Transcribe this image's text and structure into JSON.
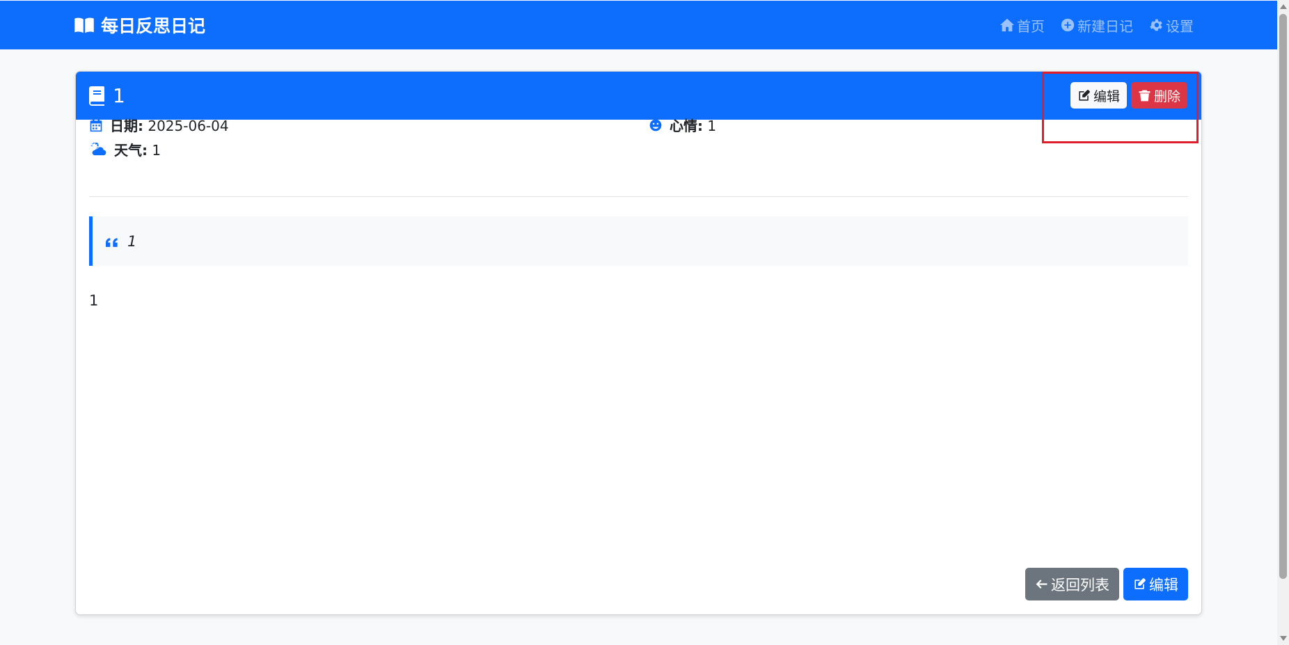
{
  "navbar": {
    "brand": "每日反思日记",
    "links": [
      {
        "label": "首页",
        "icon": "home-icon"
      },
      {
        "label": "新建日记",
        "icon": "plus-circle-icon"
      },
      {
        "label": "设置",
        "icon": "gear-icon"
      }
    ]
  },
  "entry": {
    "title": "1",
    "actions": {
      "edit": "编辑",
      "delete": "删除"
    },
    "date_label": "日期:",
    "date_value": "2025-06-04",
    "mood_label": "心情:",
    "mood_value": "1",
    "weather_label": "天气:",
    "weather_value": "1",
    "quote": "1",
    "content": "1"
  },
  "footer": {
    "back": "返回列表",
    "edit": "编辑"
  },
  "colors": {
    "primary": "#0d6efd",
    "danger": "#dc3545",
    "secondary": "#6c757d",
    "highlight": "#e01e2b"
  }
}
